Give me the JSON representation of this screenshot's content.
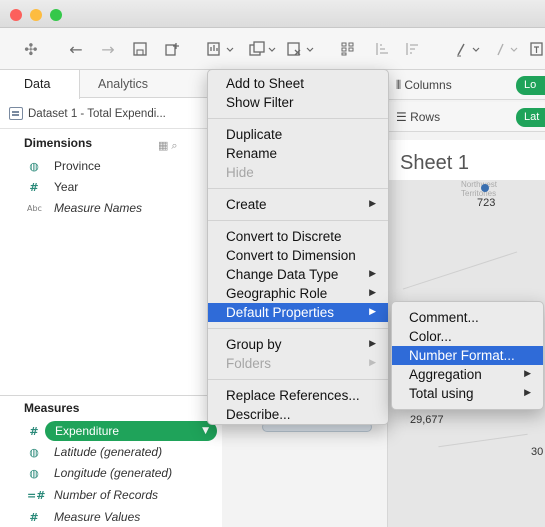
{
  "window": {
    "traffic_lights": [
      "#fc605c",
      "#fdbc40",
      "#34c84a"
    ]
  },
  "toolbar": {
    "icons": [
      "tableau-logo-icon",
      "back-icon",
      "forward-icon",
      "save-icon",
      "new-datasource-icon",
      "new-worksheet-icon",
      "duplicate-icon",
      "clear-icon",
      "swap-icon",
      "sort-ascending-icon",
      "sort-descending-icon",
      "highlight-icon",
      "group-icon",
      "label-icon"
    ]
  },
  "left_pane": {
    "tabs": {
      "data": "Data",
      "analytics": "Analytics"
    },
    "datasource": "Dataset 1 - Total Expendi...",
    "dimensions": {
      "header": "Dimensions",
      "items": [
        {
          "icon": "globe-icon",
          "label": "Province"
        },
        {
          "icon": "hash-icon",
          "label": "Year"
        },
        {
          "icon": "abc-icon",
          "label": "Measure Names"
        }
      ]
    },
    "measures": {
      "header": "Measures",
      "items": [
        {
          "icon": "hash-icon",
          "label": "Expenditure"
        },
        {
          "icon": "globe-icon",
          "label": "Latitude (generated)"
        },
        {
          "icon": "globe-icon",
          "label": "Longitude (generated)"
        },
        {
          "icon": "hash-icon",
          "label": "Number of Records"
        },
        {
          "icon": "hash-icon",
          "label": "Measure Values"
        }
      ]
    }
  },
  "shelves": {
    "columns": {
      "label": "Columns",
      "pill": "Lo"
    },
    "rows": {
      "label": "Rows",
      "pill": "Lat"
    }
  },
  "sheet": {
    "title": "Sheet 1",
    "map_labels": [
      "723",
      "29,677",
      "30"
    ],
    "map_ghost": [
      "Northwest",
      "Territories"
    ],
    "mark_color": "#3a6fb0"
  },
  "context_menu": {
    "items": [
      "Add to Sheet",
      "Show Filter",
      "Duplicate",
      "Rename",
      "Hide",
      "Create",
      "Convert to Discrete",
      "Convert to Dimension",
      "Change Data Type",
      "Geographic Role",
      "Default Properties",
      "Group by",
      "Folders",
      "Replace References...",
      "Describe..."
    ],
    "active_item": "Default Properties",
    "disabled_items": [
      "Hide",
      "Folders"
    ],
    "highlight_color": "#2f6bd8"
  },
  "submenu": {
    "items": [
      "Comment...",
      "Color...",
      "Number Format...",
      "Aggregation",
      "Total using"
    ],
    "active_item": "Number Format..."
  }
}
